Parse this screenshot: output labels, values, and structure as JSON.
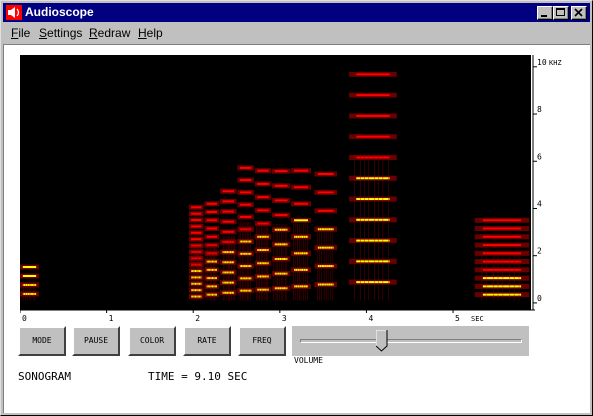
{
  "window": {
    "title": "Audioscope",
    "app_icon": "speaker-icon"
  },
  "title_buttons": [
    {
      "name": "minimize",
      "icon": "minimize-icon"
    },
    {
      "name": "maximize",
      "icon": "maximize-icon"
    },
    {
      "name": "close",
      "icon": "close-icon"
    }
  ],
  "menu": {
    "file": {
      "first": "F",
      "rest": "ile"
    },
    "settings": {
      "first": "S",
      "rest": "ettings"
    },
    "redraw": {
      "first": "R",
      "rest": "edraw"
    },
    "help": {
      "first": "H",
      "rest": "elp"
    }
  },
  "chart_data": {
    "type": "heatmap",
    "title": "",
    "x_unit": "SEC",
    "y_unit": "KHZ",
    "x_ticks": [
      0,
      1,
      2,
      3,
      4,
      5
    ],
    "y_ticks": [
      0,
      2,
      4,
      6,
      8,
      10
    ],
    "xlim": [
      0,
      5.9
    ],
    "ylim": [
      -0.3,
      10.5
    ],
    "colormap": [
      "#000000",
      "#8b0000",
      "#ff0000",
      "#ffff00"
    ],
    "events": [
      {
        "t0": 0.0,
        "t1": 0.22,
        "f0": 0.38,
        "harmonics": 4,
        "level": 0.8
      },
      {
        "t0": 1.95,
        "t1": 2.12,
        "f0": 0.27,
        "harmonics": 15,
        "level": 0.9
      },
      {
        "t0": 2.13,
        "t1": 2.3,
        "f0": 0.35,
        "harmonics": 12,
        "level": 0.9
      },
      {
        "t0": 2.31,
        "t1": 2.5,
        "f0": 0.43,
        "harmonics": 11,
        "level": 0.85
      },
      {
        "t0": 2.51,
        "t1": 2.7,
        "f0": 0.52,
        "harmonics": 11,
        "level": 0.85
      },
      {
        "t0": 2.71,
        "t1": 2.9,
        "f0": 0.56,
        "harmonics": 10,
        "level": 0.85
      },
      {
        "t0": 2.91,
        "t1": 3.12,
        "f0": 0.62,
        "harmonics": 9,
        "level": 0.85
      },
      {
        "t0": 3.13,
        "t1": 3.36,
        "f0": 0.7,
        "harmonics": 8,
        "level": 0.85
      },
      {
        "t0": 3.4,
        "t1": 3.66,
        "f0": 0.78,
        "harmonics": 7,
        "level": 0.8
      },
      {
        "t0": 3.8,
        "t1": 4.35,
        "f0": 0.88,
        "harmonics": 12,
        "level": 1.0
      },
      {
        "t0": 5.25,
        "t1": 5.88,
        "f0": 0.35,
        "harmonics": 10,
        "level": 0.75
      }
    ]
  },
  "controls": {
    "mode": "MODE",
    "pause": "PAUSE",
    "color": "COLOR",
    "rate": "RATE",
    "freq": "FREQ"
  },
  "volume": {
    "label": "VOLUME",
    "level": 0.37
  },
  "status": {
    "mode_text": "SONOGRAM",
    "time_text": "TIME = 9.10 SEC"
  }
}
